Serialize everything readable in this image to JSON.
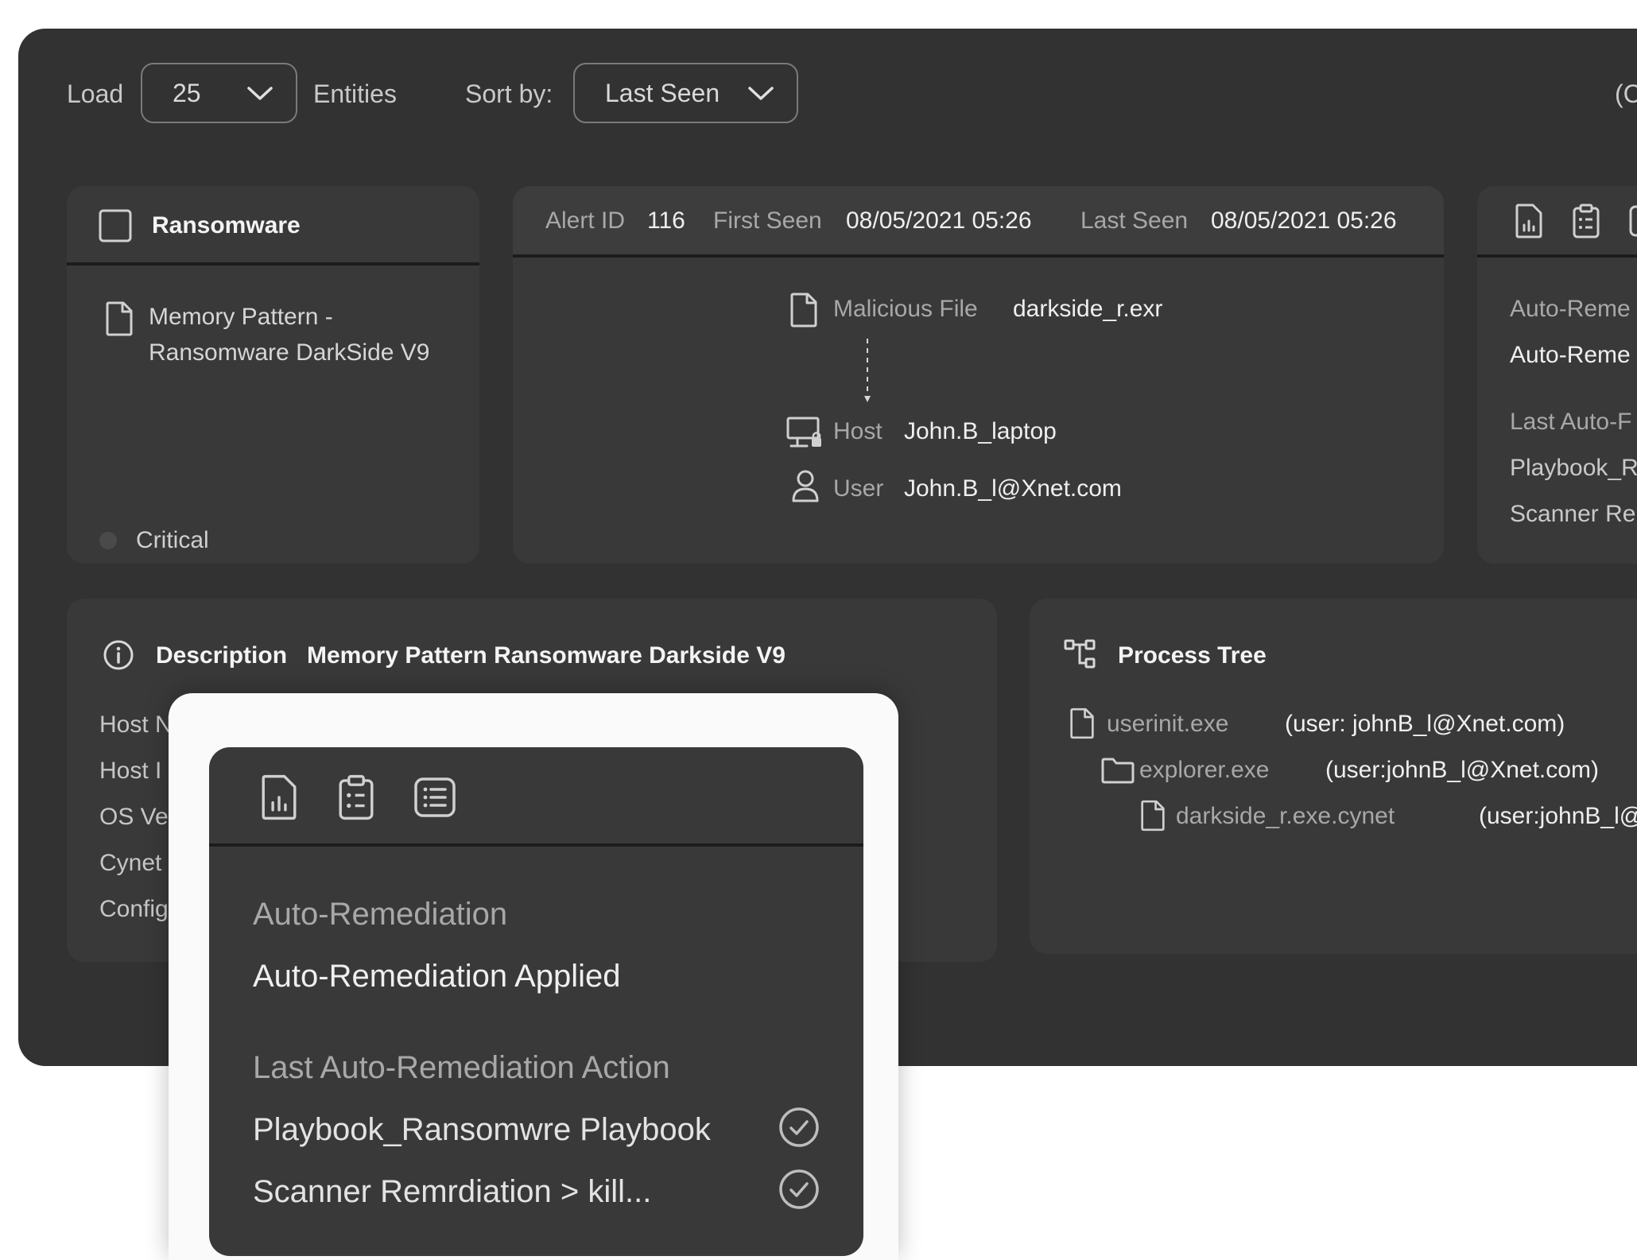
{
  "toolbar": {
    "load_label": "Load",
    "load_value": "25",
    "entities_label": "Entities",
    "sort_label": "Sort by:",
    "sort_value": "Last Seen",
    "right_fragment": "(C"
  },
  "alert_card": {
    "title": "Ransomware",
    "name": [
      "Memory Pattern -",
      "Ransomware DarkSide V9"
    ],
    "severity": "Critical"
  },
  "details_card": {
    "alert_id_label": "Alert ID",
    "alert_id": "116",
    "first_seen_label": "First Seen",
    "first_seen": "08/05/2021 05:26",
    "last_seen_label": "Last Seen",
    "last_seen": "08/05/2021 05:26",
    "file_label": "Malicious File",
    "file_value": "darkside_r.exr",
    "host_label": "Host",
    "host_value": "John.B_laptop",
    "user_label": "User",
    "user_value": "John.B_l@Xnet.com"
  },
  "remediation_card": {
    "lines": [
      "Auto-Reme",
      "Auto-Reme",
      "Last Auto-F",
      "Playbook_R",
      "Scanner Re"
    ]
  },
  "description_card": {
    "label": "Description",
    "value": "Memory Pattern Ransomware Darkside V9",
    "rows": [
      "Host N",
      "Host I",
      "OS Ve",
      "Cynet",
      "Config"
    ]
  },
  "process_tree": {
    "title": "Process Tree",
    "items": [
      {
        "name": "userinit.exe",
        "user": "(user: johnB_l@Xnet.com)"
      },
      {
        "name": "explorer.exe",
        "user": "(user:johnB_l@Xnet.com)"
      },
      {
        "name": "darkside_r.exe.cynet",
        "user": "(user:johnB_l@X"
      }
    ]
  },
  "popup": {
    "heading": "Auto-Remediation",
    "status": "Auto-Remediation Applied",
    "last_action_label": "Last Auto-Remediation Action",
    "actions": [
      "Playbook_Ransomwre Playbook",
      "Scanner Remrdiation > kill..."
    ]
  }
}
